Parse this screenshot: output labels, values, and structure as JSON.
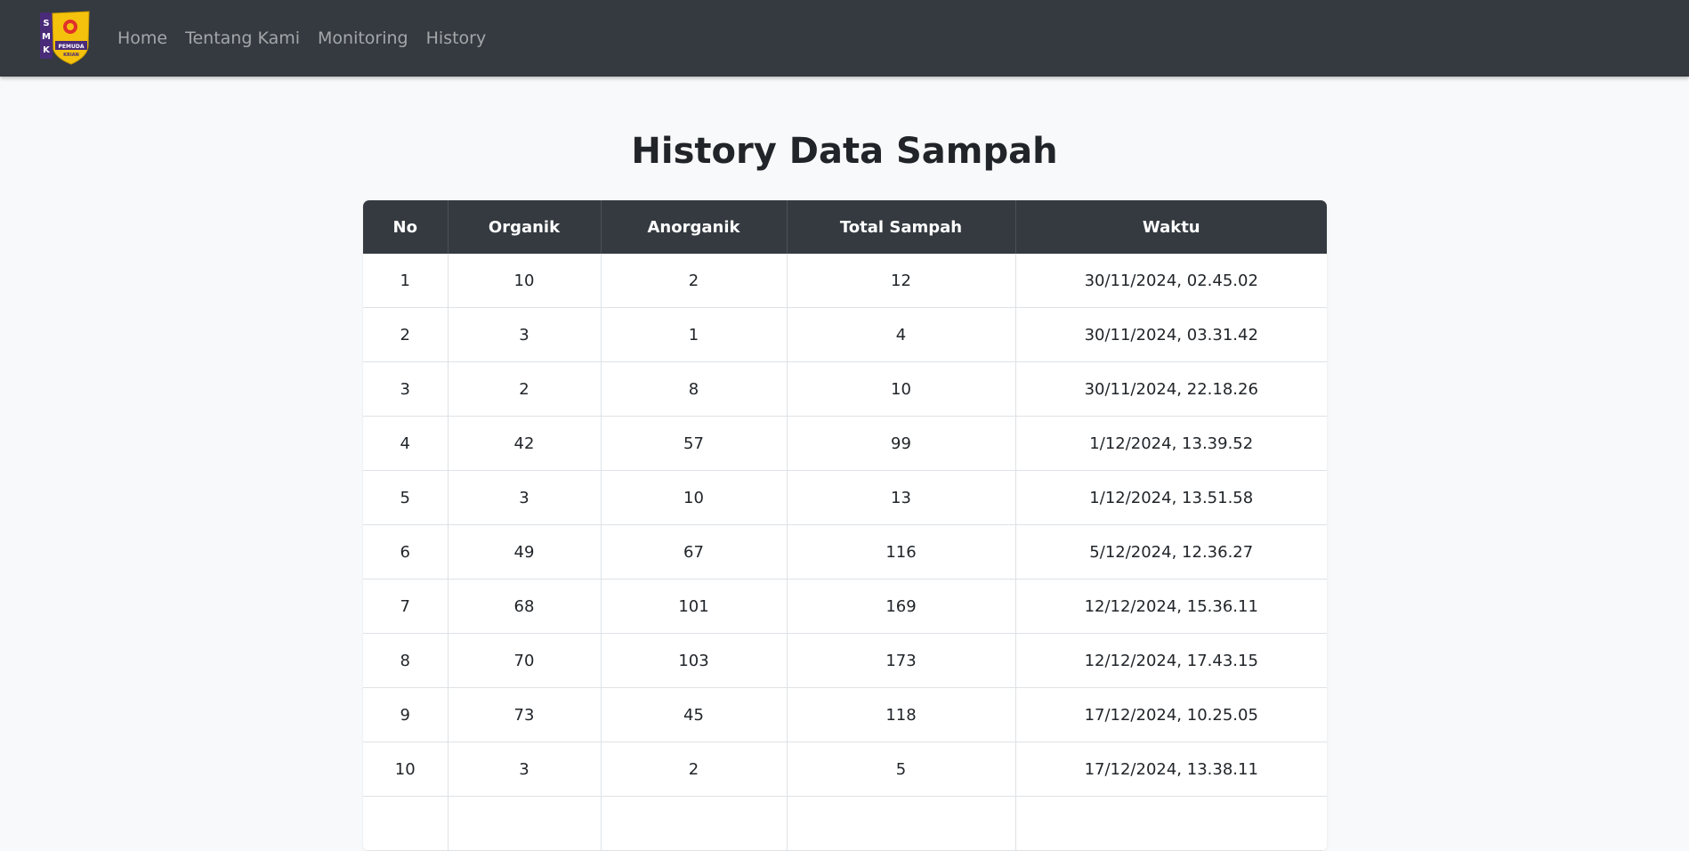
{
  "navbar": {
    "logo": {
      "side_letters": [
        "S",
        "M",
        "K"
      ],
      "text_line1": "PEMUDA",
      "text_line2": "KRIAN",
      "colors": {
        "purple": "#4a2b7a",
        "yellow": "#f4c20d",
        "emblem": "#e0302b"
      }
    },
    "links": [
      {
        "label": "Home"
      },
      {
        "label": "Tentang Kami"
      },
      {
        "label": "Monitoring"
      },
      {
        "label": "History"
      }
    ],
    "background": "#343a40"
  },
  "page_title": "History Data Sampah",
  "table": {
    "columns": [
      "No",
      "Organik",
      "Anorganik",
      "Total Sampah",
      "Waktu"
    ],
    "rows": [
      [
        "1",
        "10",
        "2",
        "12",
        "30/11/2024, 02.45.02"
      ],
      [
        "2",
        "3",
        "1",
        "4",
        "30/11/2024, 03.31.42"
      ],
      [
        "3",
        "2",
        "8",
        "10",
        "30/11/2024, 22.18.26"
      ],
      [
        "4",
        "42",
        "57",
        "99",
        "1/12/2024, 13.39.52"
      ],
      [
        "5",
        "3",
        "10",
        "13",
        "1/12/2024, 13.51.58"
      ],
      [
        "6",
        "49",
        "67",
        "116",
        "5/12/2024, 12.36.27"
      ],
      [
        "7",
        "68",
        "101",
        "169",
        "12/12/2024, 15.36.11"
      ],
      [
        "8",
        "70",
        "103",
        "173",
        "12/12/2024, 17.43.15"
      ],
      [
        "9",
        "73",
        "45",
        "118",
        "17/12/2024, 10.25.05"
      ],
      [
        "10",
        "3",
        "2",
        "5",
        "17/12/2024, 13.38.11"
      ],
      [
        "",
        "",
        "",
        "",
        ""
      ]
    ]
  }
}
